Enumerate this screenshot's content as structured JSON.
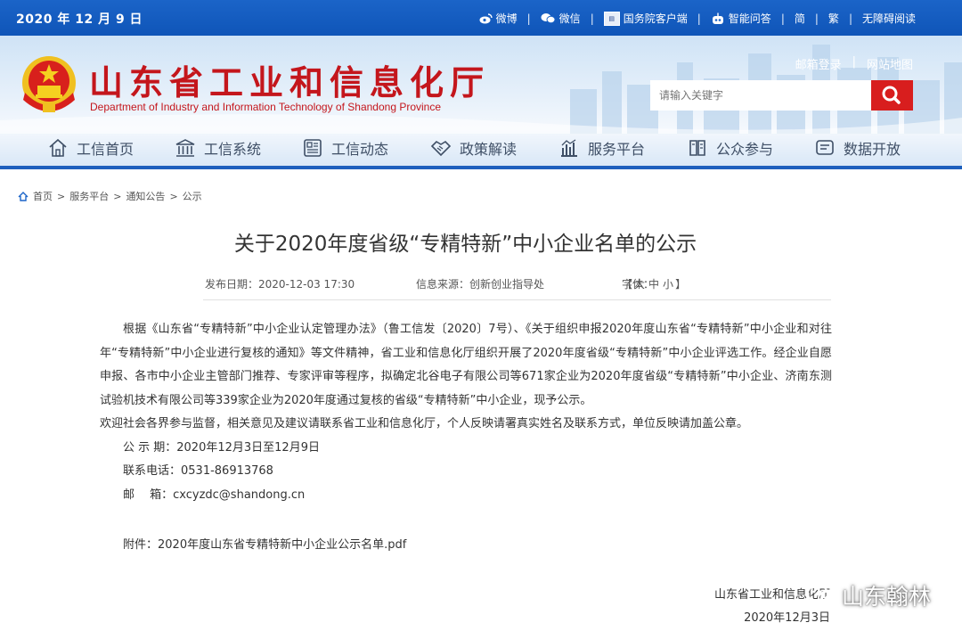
{
  "topbar": {
    "date": "2020 年 12 月 9 日",
    "links": [
      "微博",
      "微信",
      "国务院客户端",
      "智能问答",
      "简",
      "繁",
      "无障碍阅读"
    ]
  },
  "header": {
    "title": "山东省工业和信息化厅",
    "subtitle": "Department of Industry and Information Technology of Shandong Province",
    "mail_login": "邮箱登录",
    "site_map": "网站地图",
    "search_placeholder": "请输入关键字"
  },
  "nav": [
    "工信首页",
    "工信系统",
    "工信动态",
    "政策解读",
    "服务平台",
    "公众参与",
    "数据开放"
  ],
  "breadcrumb": [
    "首页",
    "服务平台",
    "通知公告",
    "公示"
  ],
  "article": {
    "title": "关于2020年度省级“专精特新”中小企业名单的公示",
    "publish_date": "发布日期：2020-12-03 17:30",
    "source": "信息来源：创新创业指导处",
    "font_label": "字体：",
    "font_sizes": [
      "大",
      "中",
      "小"
    ],
    "paragraph1": "根据《山东省“专精特新”中小企业认定管理办法》（鲁工信发〔2020〕7号）、《关于组织申报2020年度山东省“专精特新”中小企业和对往年“专精特新”中小企业进行复核的通知》等文件精神，省工业和信息化厅组织开展了2020年度省级“专精特新”中小企业评选工作。经企业自愿申报、各市中小企业主管部门推荐、专家评审等程序，拟确定北谷电子有限公司等671家企业为2020年度省级“专精特新”中小企业、济南东测试验机技术有限公司等339家企业为2020年度通过复核的省级“专精特新”中小企业，现予公示。",
    "paragraph2": "欢迎社会各界参与监督，相关意见及建议请联系省工业和信息化厅，个人反映请署真实姓名及联系方式，单位反映请加盖公章。",
    "period": "公 示 期：2020年12月3日至12月9日",
    "phone": "联系电话：0531-86913768",
    "email": "邮　 箱：cxcyzdc@shandong.cn",
    "attachment": "附件：2020年度山东省专精特新中小企业公示名单.pdf",
    "sign_org": "山东省工业和信息化厅",
    "sign_date": "2020年12月3日"
  },
  "watermark": "山东翰林",
  "colors": {
    "brand_blue": "#1b64c8",
    "title_red": "#c4161c",
    "search_red": "#d81e1e"
  }
}
